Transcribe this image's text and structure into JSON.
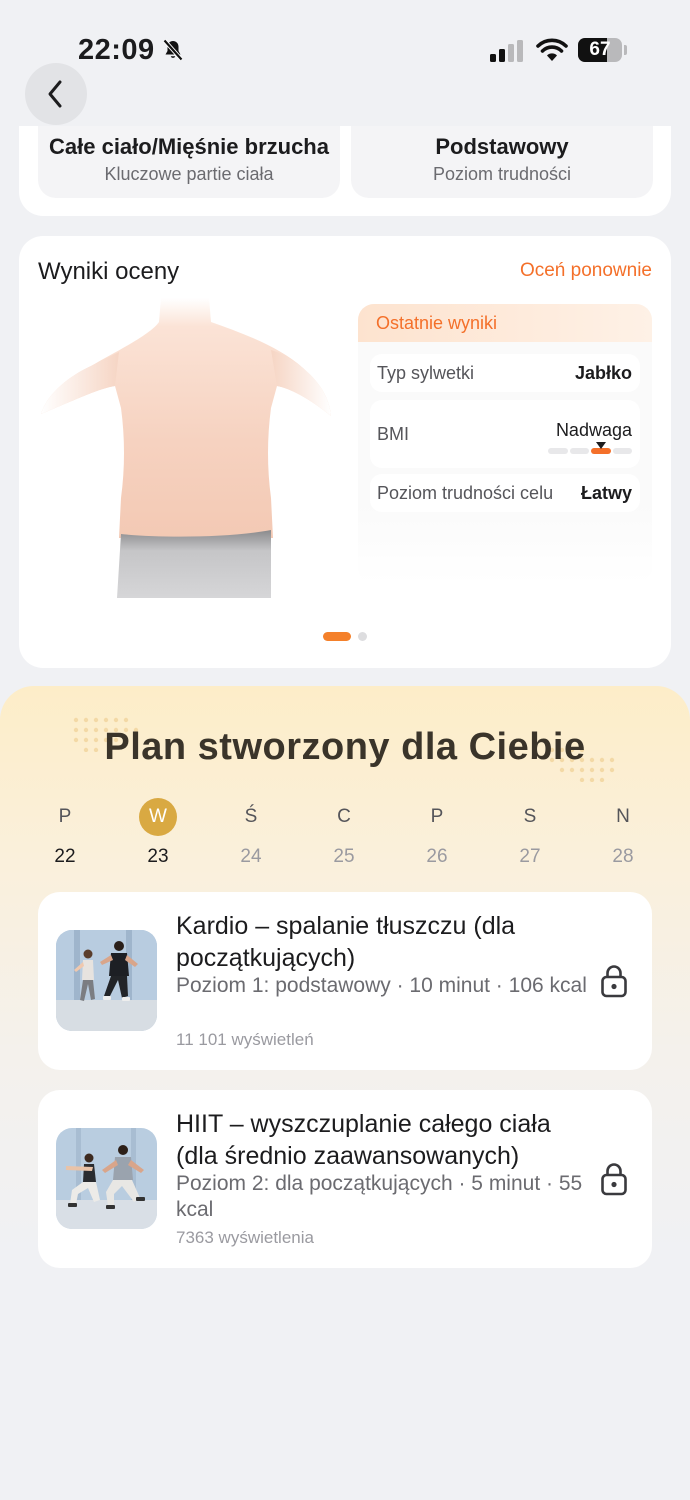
{
  "status_bar": {
    "time": "22:09",
    "battery": "67",
    "battery_level": 0.67
  },
  "nav": {
    "back_icon": "chevron-left-icon"
  },
  "top_chips": [
    {
      "title": "Całe ciało/Mięśnie brzucha",
      "subtitle": "Kluczowe partie ciała"
    },
    {
      "title": "Podstawowy",
      "subtitle": "Poziom trudności"
    }
  ],
  "evaluation": {
    "title": "Wyniki oceny",
    "reassess_label": "Oceń ponownie",
    "results_header": "Ostatnie wyniki",
    "rows": [
      {
        "label": "Typ sylwetki",
        "value": "Jabłko"
      },
      {
        "label": "BMI",
        "value": "Nadwaga"
      },
      {
        "label": "Poziom trudności celu",
        "value": "Łatwy"
      }
    ],
    "bmi_level_segment": 3,
    "bmi_segments": 4,
    "pages": 2,
    "current_page": 1
  },
  "plan": {
    "title": "Plan stworzony dla Ciebie",
    "days": [
      {
        "letter": "P",
        "num": "22",
        "state": "past"
      },
      {
        "letter": "W",
        "num": "23",
        "state": "selected"
      },
      {
        "letter": "Ś",
        "num": "24",
        "state": "future"
      },
      {
        "letter": "C",
        "num": "25",
        "state": "future"
      },
      {
        "letter": "P",
        "num": "26",
        "state": "future"
      },
      {
        "letter": "S",
        "num": "27",
        "state": "future"
      },
      {
        "letter": "N",
        "num": "28",
        "state": "future"
      }
    ],
    "workouts": [
      {
        "title": "Kardio – spalanie tłuszczu (dla początkujących)",
        "meta": "Poziom 1: podstawowy · 10 minut · 106 kcal",
        "views": "11 101 wyświetleń",
        "lock_icon": "lock-icon"
      },
      {
        "title": "HIIT – wyszczuplanie całego ciała (dla średnio zaawansowanych)",
        "meta": "Poziom 2: dla początkujących · 5 minut · 55 kcal",
        "views": "7363 wyświetlenia",
        "lock_icon": "lock-icon"
      }
    ]
  },
  "colors": {
    "accent": "#f4702a",
    "selected_day": "#d9a942"
  }
}
